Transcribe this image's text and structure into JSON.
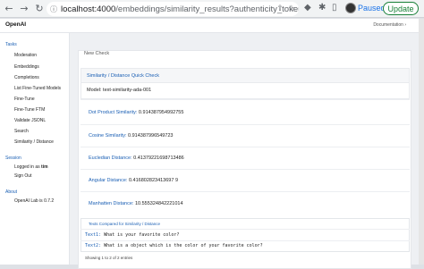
{
  "browser": {
    "url_host": "localhost:4000",
    "url_rest": "/embeddings/similarity_results?authenticity_token=hX...",
    "paused_label": "Paused",
    "update_label": "Update"
  },
  "app": {
    "brand": "OpenAI",
    "docs_link": "Documentation ›"
  },
  "sidebar": {
    "tasks_heading": "Tasks",
    "items": [
      {
        "label": "Moderation"
      },
      {
        "label": "Embeddings"
      },
      {
        "label": "Completions"
      },
      {
        "label": "List Fine-Tuned Models"
      },
      {
        "label": "Fine-Tune"
      },
      {
        "label": "Fine-Tune FTM"
      },
      {
        "label": "Validate JSONL"
      },
      {
        "label": "Search"
      },
      {
        "label": "Similarity / Distance"
      }
    ],
    "session_heading": "Session",
    "logged_in": "Logged in as ",
    "user": "tim",
    "sign_out": "Sign Out",
    "about_heading": "About",
    "version": "OpenAI Lab is 0.7.2"
  },
  "main": {
    "new_check": "New Check",
    "quick_check_title": "Similarity / Distance Quick Check",
    "model": "Model: text-similarity-ada-001",
    "metrics": [
      {
        "label": "Dot Product Similarity:",
        "value": " 0.914387954992755"
      },
      {
        "label": "Cosine Similarity:",
        "value": " 0.914387996549723"
      },
      {
        "label": "Eucledian Distance:",
        "value": " 0.41379221698713486"
      },
      {
        "label": "Angular Distance:",
        "value": " 0.416802823413697 9"
      },
      {
        "label": "Manhatten Distance:",
        "value": " 10.555324842221014"
      }
    ],
    "texts_title": "Texts Compared for Similarity / Distance",
    "text1_label": "Text1:",
    "text1_value": " What is your favorite color?",
    "text2_label": "Text2:",
    "text2_value": " What is a object which is the color of your favorite color?",
    "entries": "Showing 1 to 2 of 2 entries"
  }
}
